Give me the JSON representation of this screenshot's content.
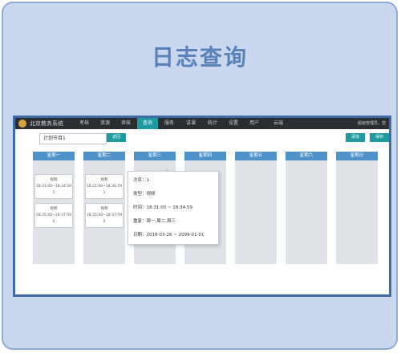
{
  "page": {
    "title": "日志查询"
  },
  "app": {
    "brand": "北京教务系统",
    "user": "超级管理员，您",
    "nav": [
      "考核",
      "资源",
      "审核",
      "查询",
      "服务",
      "讲课",
      "统计",
      "设置",
      "用户",
      "云端"
    ],
    "active_nav": "查询"
  },
  "toolbar": {
    "search_value": "计划节目1",
    "back_label": "返回",
    "add_label": "添加",
    "save_label": "保存"
  },
  "week": {
    "days": [
      "星期一",
      "星期二",
      "星期三",
      "星期四",
      "星期五",
      "星期六",
      "星期日"
    ],
    "events": [
      {
        "day": 0,
        "title": "视频",
        "time": "18:31:00~18:34:59",
        "num": "1"
      },
      {
        "day": 0,
        "title": "视频",
        "time": "18:35:00~18:37:59",
        "num": "2"
      },
      {
        "day": 1,
        "title": "视频",
        "time": "18:21:00~18:34:59",
        "num": "1"
      },
      {
        "day": 1,
        "title": "视频",
        "time": "18:35:00~18:37:59",
        "num": "2"
      }
    ]
  },
  "tooltip": {
    "order": "次序：1",
    "type": "类型：视频",
    "time": "时间：18:31:00 ~ 18:34:59",
    "repeat": "重复：周一,周二,周三",
    "date": "日期：2018-03-26 ~ 2099-01-01"
  },
  "colors": {
    "accent": "#1e9aa0",
    "day_header": "#4f92c9",
    "frame": "#3e6aa6",
    "card_bg": "#c9d8ee"
  }
}
